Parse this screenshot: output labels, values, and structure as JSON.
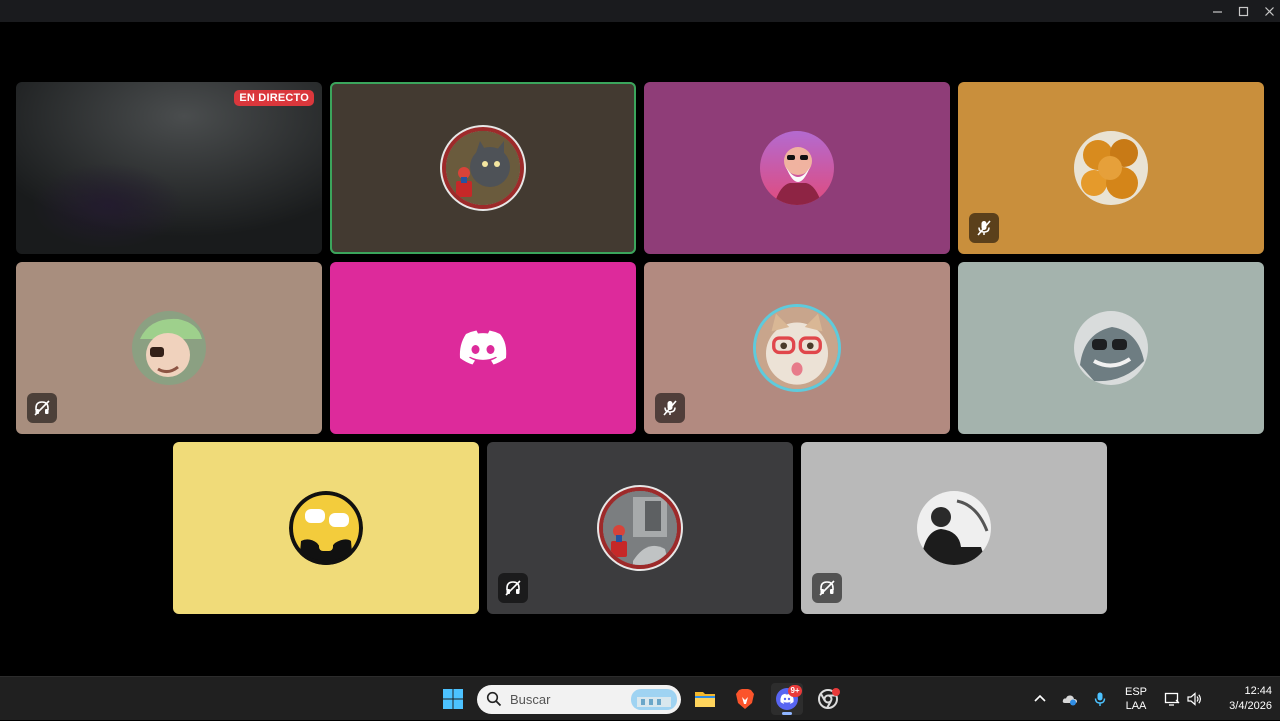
{
  "window": {
    "controls": [
      "minimize-icon",
      "maximize-icon",
      "close-icon"
    ]
  },
  "participants": [
    {
      "id": "stream",
      "background": "#1c1e1f",
      "kind": "stream",
      "live_label": "EN DIRECTO"
    },
    {
      "id": "p2",
      "background": "#433a31",
      "avatar": "cat-figurine",
      "speaking": true,
      "status": null
    },
    {
      "id": "p3",
      "background": "#8f3d78",
      "avatar": "old-master",
      "status": null
    },
    {
      "id": "p4",
      "background": "#c98f3c",
      "avatar": "fried-balls",
      "status": "mic-muted"
    },
    {
      "id": "p5",
      "background": "#a88e7e",
      "avatar": "cap-guy",
      "status": "deafened"
    },
    {
      "id": "p6",
      "background": "#dd2a9b",
      "avatar": "discord-logo",
      "status": null
    },
    {
      "id": "p7",
      "background": "#b28a80",
      "avatar": "glasses-cat",
      "status": "mic-muted",
      "ring": true
    },
    {
      "id": "p8",
      "background": "#a4b3ad",
      "avatar": "goggles-shark",
      "status": null
    },
    {
      "id": "p9",
      "background": "#f0db79",
      "avatar": "sunglasses-face",
      "status": null
    },
    {
      "id": "p10",
      "background": "#3c3c3e",
      "avatar": "figurine-room",
      "status": "deafened"
    },
    {
      "id": "p11",
      "background": "#b9b9b9",
      "avatar": "bw-photo",
      "status": "deafened"
    }
  ],
  "taskbar": {
    "search_placeholder": "Buscar",
    "apps": [
      "windows-start-icon",
      "file-explorer-icon",
      "brave-browser-icon",
      "discord-icon",
      "chrome-like-icon"
    ],
    "discord_badge": "9+",
    "language": {
      "line1": "ESP",
      "line2": "LAA"
    },
    "clock": {
      "time": "12:44",
      "date": "3/4/2026"
    }
  },
  "colors": {
    "speaking": "#3ba55c",
    "live": "#da373c",
    "discord_blurple": "#5865f2"
  }
}
